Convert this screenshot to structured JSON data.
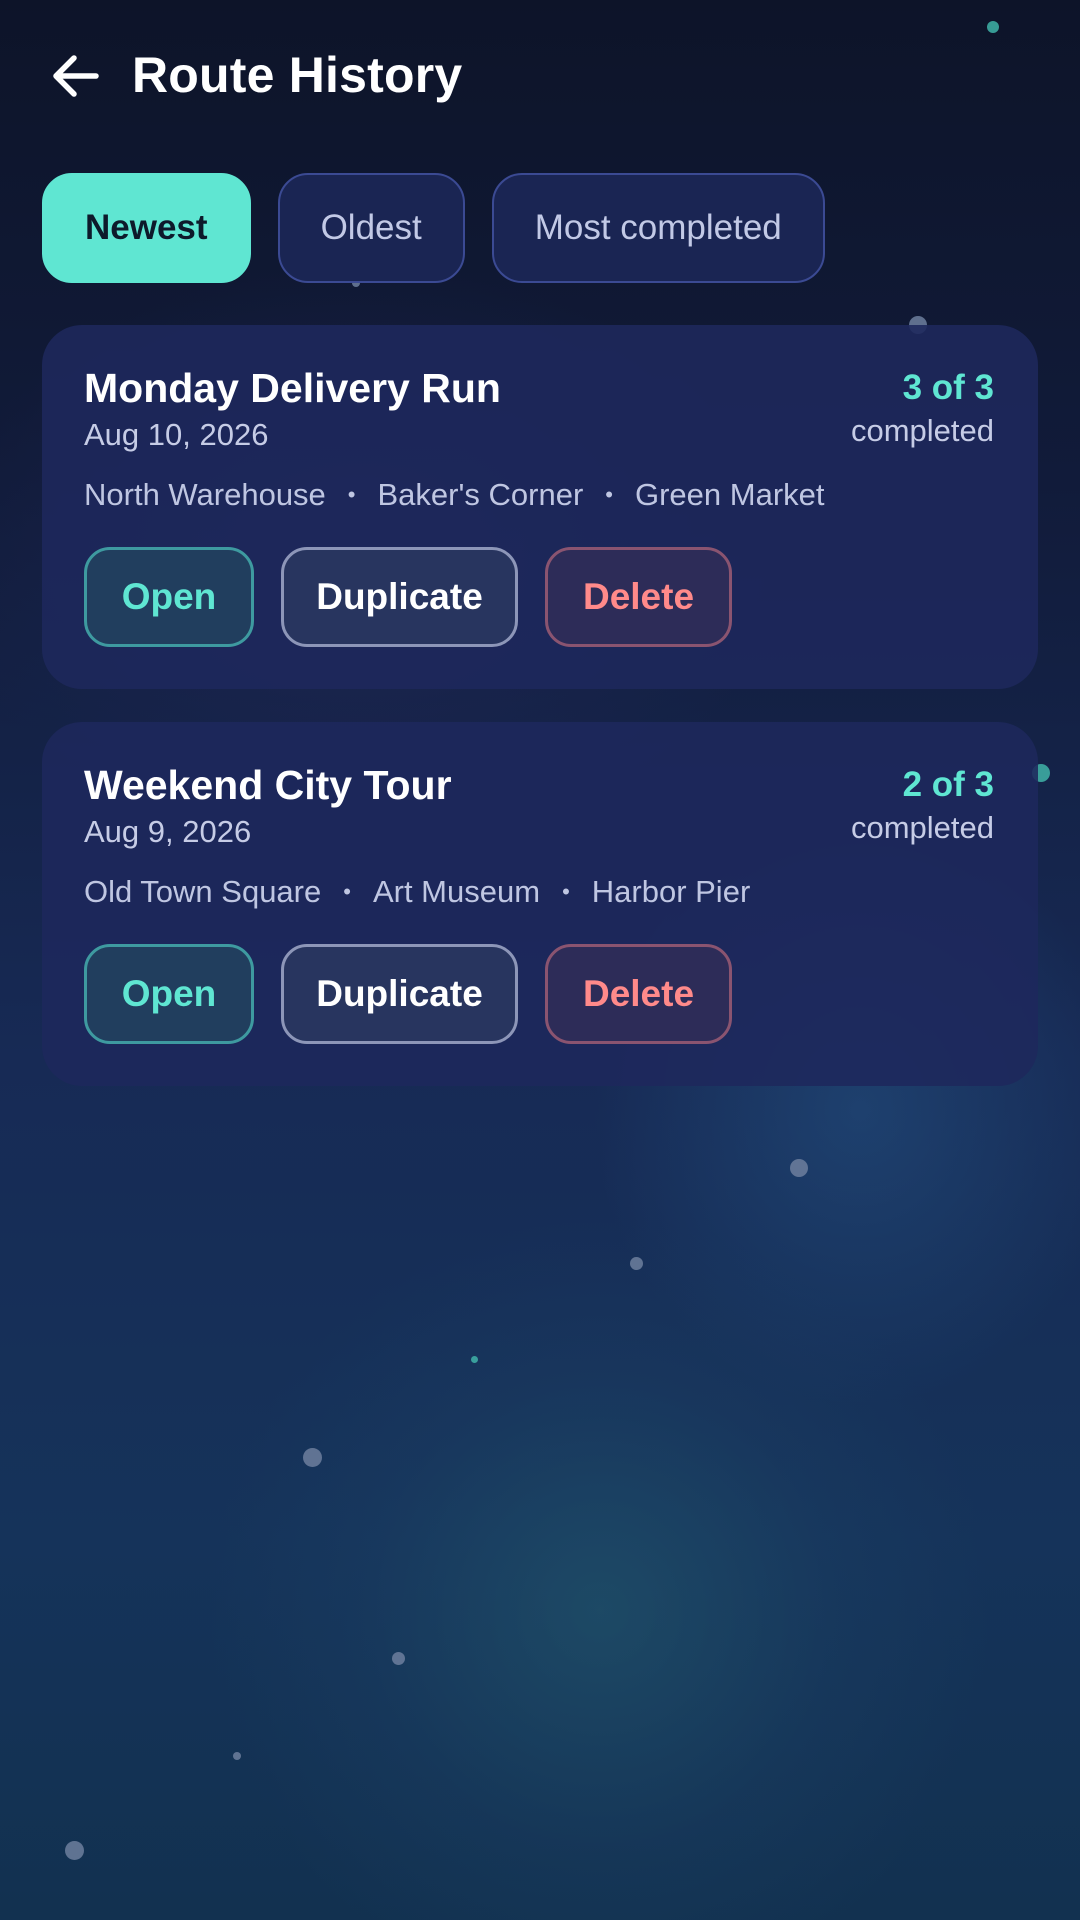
{
  "header": {
    "title": "Route History",
    "back_icon": "arrow-left-icon"
  },
  "sort_options": [
    {
      "label": "Newest",
      "selected": true
    },
    {
      "label": "Oldest",
      "selected": false
    },
    {
      "label": "Most completed",
      "selected": false
    }
  ],
  "routes": [
    {
      "name": "Monday Delivery Run",
      "date": "Aug 10, 2026",
      "progress": "3 of 3",
      "progress_label": "completed",
      "stops": [
        "North Warehouse",
        "Baker's Corner",
        "Green Market"
      ],
      "actions": {
        "open": "Open",
        "duplicate": "Duplicate",
        "delete": "Delete"
      }
    },
    {
      "name": "Weekend City Tour",
      "date": "Aug 9, 2026",
      "progress": "2 of 3",
      "progress_label": "completed",
      "stops": [
        "Old Town Square",
        "Art Museum",
        "Harbor Pier"
      ],
      "actions": {
        "open": "Open",
        "duplicate": "Duplicate",
        "delete": "Delete"
      }
    }
  ],
  "colors": {
    "accent": "#5fe6d2",
    "danger": "#ff8a8a",
    "card": "#1e285c",
    "background": "#111b3a"
  }
}
